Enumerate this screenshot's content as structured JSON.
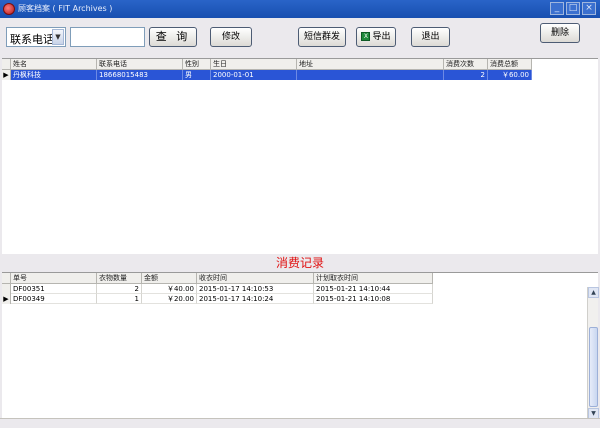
{
  "window": {
    "title": "顾客档案 ( FIT Archives )"
  },
  "title_buttons": {
    "minimize": "_",
    "maximize": "□",
    "close": "×"
  },
  "toolbar": {
    "search_field": "联系电话",
    "search_value": "",
    "query_label": "查 询",
    "modify_label": "修改",
    "sms_label": "短信群发",
    "export_label": "导出",
    "exit_label": "退出",
    "delete_label": "删除",
    "export_icon": "excel-icon"
  },
  "customers": {
    "columns": [
      "姓名",
      "联系电话",
      "性别",
      "生日",
      "地址",
      "消费次数",
      "消费总额"
    ],
    "rows": [
      {
        "name": "丹枫科技",
        "phone": "18668015483",
        "gender": "男",
        "birthday": "2000-01-01",
        "address": "",
        "visits": "2",
        "total": "￥60.00"
      }
    ]
  },
  "records": {
    "title": "消费记录",
    "columns": [
      "单号",
      "衣物数量",
      "金额",
      "收衣时间",
      "计划取衣时间"
    ],
    "rows": [
      {
        "order": "DF00351",
        "qty": "2",
        "amount": "￥40.00",
        "received": "2015-01-17 14:10:53",
        "pickup": "2015-01-21 14:10:44"
      },
      {
        "order": "DF00349",
        "qty": "1",
        "amount": "￥20.00",
        "received": "2015-01-17 14:10:24",
        "pickup": "2015-01-21 14:10:08"
      }
    ]
  },
  "colors": {
    "selection": "#2a55d6",
    "section_title": "#e01010",
    "titlebar": "#2a64c8"
  }
}
